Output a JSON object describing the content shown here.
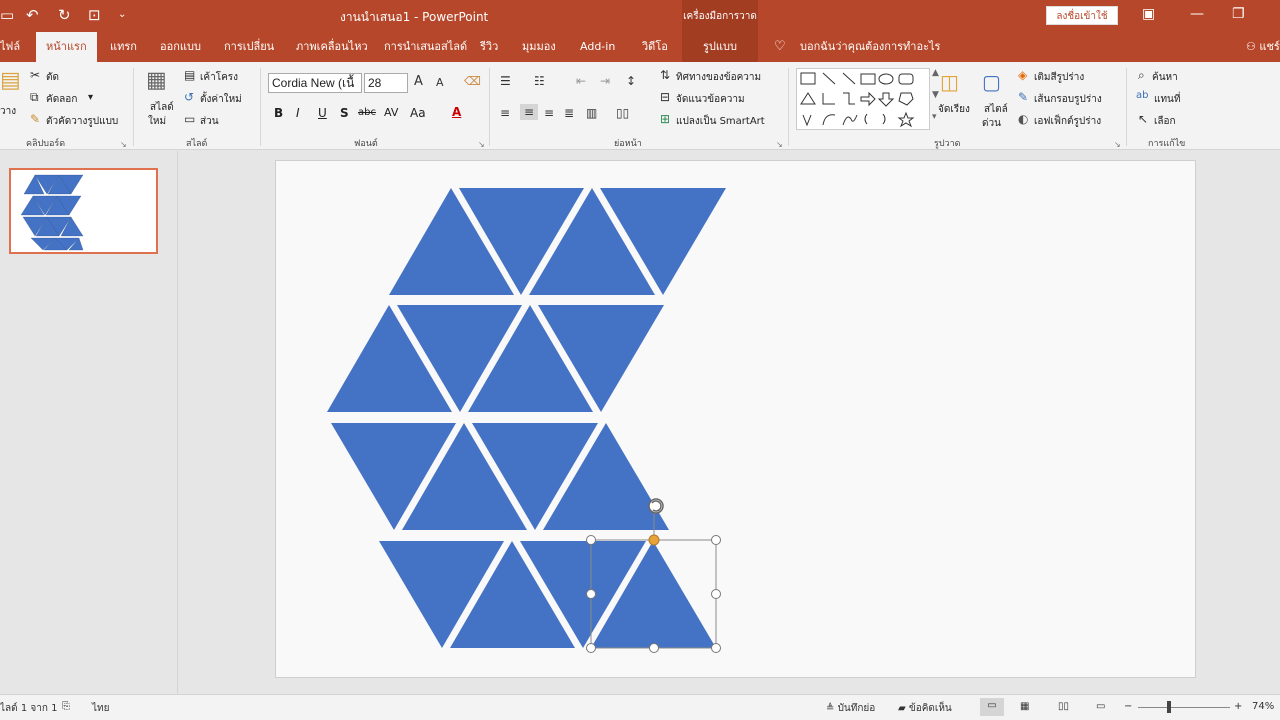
{
  "title_bar": {
    "document_title": "งานนำเสนอ1  -  PowerPoint",
    "context_title": "เครื่องมือการวาด",
    "signin_label": "ลงชื่อเข้าใช้"
  },
  "tabs": [
    {
      "label": "ไฟล์"
    },
    {
      "label": "หน้าแรก"
    },
    {
      "label": "แทรก"
    },
    {
      "label": "ออกแบบ"
    },
    {
      "label": "การเปลี่ยน"
    },
    {
      "label": "ภาพเคลื่อนไหว"
    },
    {
      "label": "การนำเสนอสไลด์"
    },
    {
      "label": "รีวิว"
    },
    {
      "label": "มุมมอง"
    },
    {
      "label": "Add-in"
    },
    {
      "label": "วิดีโอ"
    },
    {
      "label": "รูปแบบ"
    }
  ],
  "tell_me": "บอกฉันว่าคุณต้องการทำอะไร",
  "user_label": "แชร์",
  "ribbon": {
    "clipboard": {
      "cut": "ตัด",
      "copy": "คัดลอก",
      "format_painter": "ตัวคัดวางรูปแบบ",
      "paste": "วาง",
      "label": "คลิปบอร์ด"
    },
    "slides": {
      "new_slide_line1": "สไลด์",
      "new_slide_line2": "ใหม่",
      "layout": "เค้าโครง",
      "reset": "ตั้งค่าใหม่",
      "section": "ส่วน",
      "label": "สไลด์"
    },
    "font": {
      "font_name": "Cordia New (เนื้",
      "font_size": "28",
      "label": "ฟอนต์"
    },
    "paragraph": {
      "text_direction": "ทิศทางของข้อความ",
      "align_text": "จัดแนวข้อความ",
      "smartart": "แปลงเป็น SmartArt",
      "label": "ย่อหน้า"
    },
    "drawing": {
      "arrange": "จัดเรียง",
      "quick_styles_line1": "สไตล์",
      "quick_styles_line2": "ด่วน",
      "shape_fill": "เติมสีรูปร่าง",
      "shape_outline": "เส้นกรอบรูปร่าง",
      "shape_effects": "เอฟเฟ็กต์รูปร่าง",
      "label": "รูปวาด"
    },
    "editing": {
      "find": "ค้นหา",
      "replace": "แทนที่",
      "select": "เลือก",
      "label": "การแก้ไข"
    }
  },
  "status": {
    "slide_counter": "ไลด์ 1 จาก 1",
    "language": "ไทย",
    "notes": "บันทึกย่อ",
    "comments": "ข้อคิดเห็น",
    "zoom": "74%"
  },
  "colors": {
    "accent": "#b7472a",
    "shape_fill": "#4472c4",
    "handle": "#e7a33a"
  }
}
